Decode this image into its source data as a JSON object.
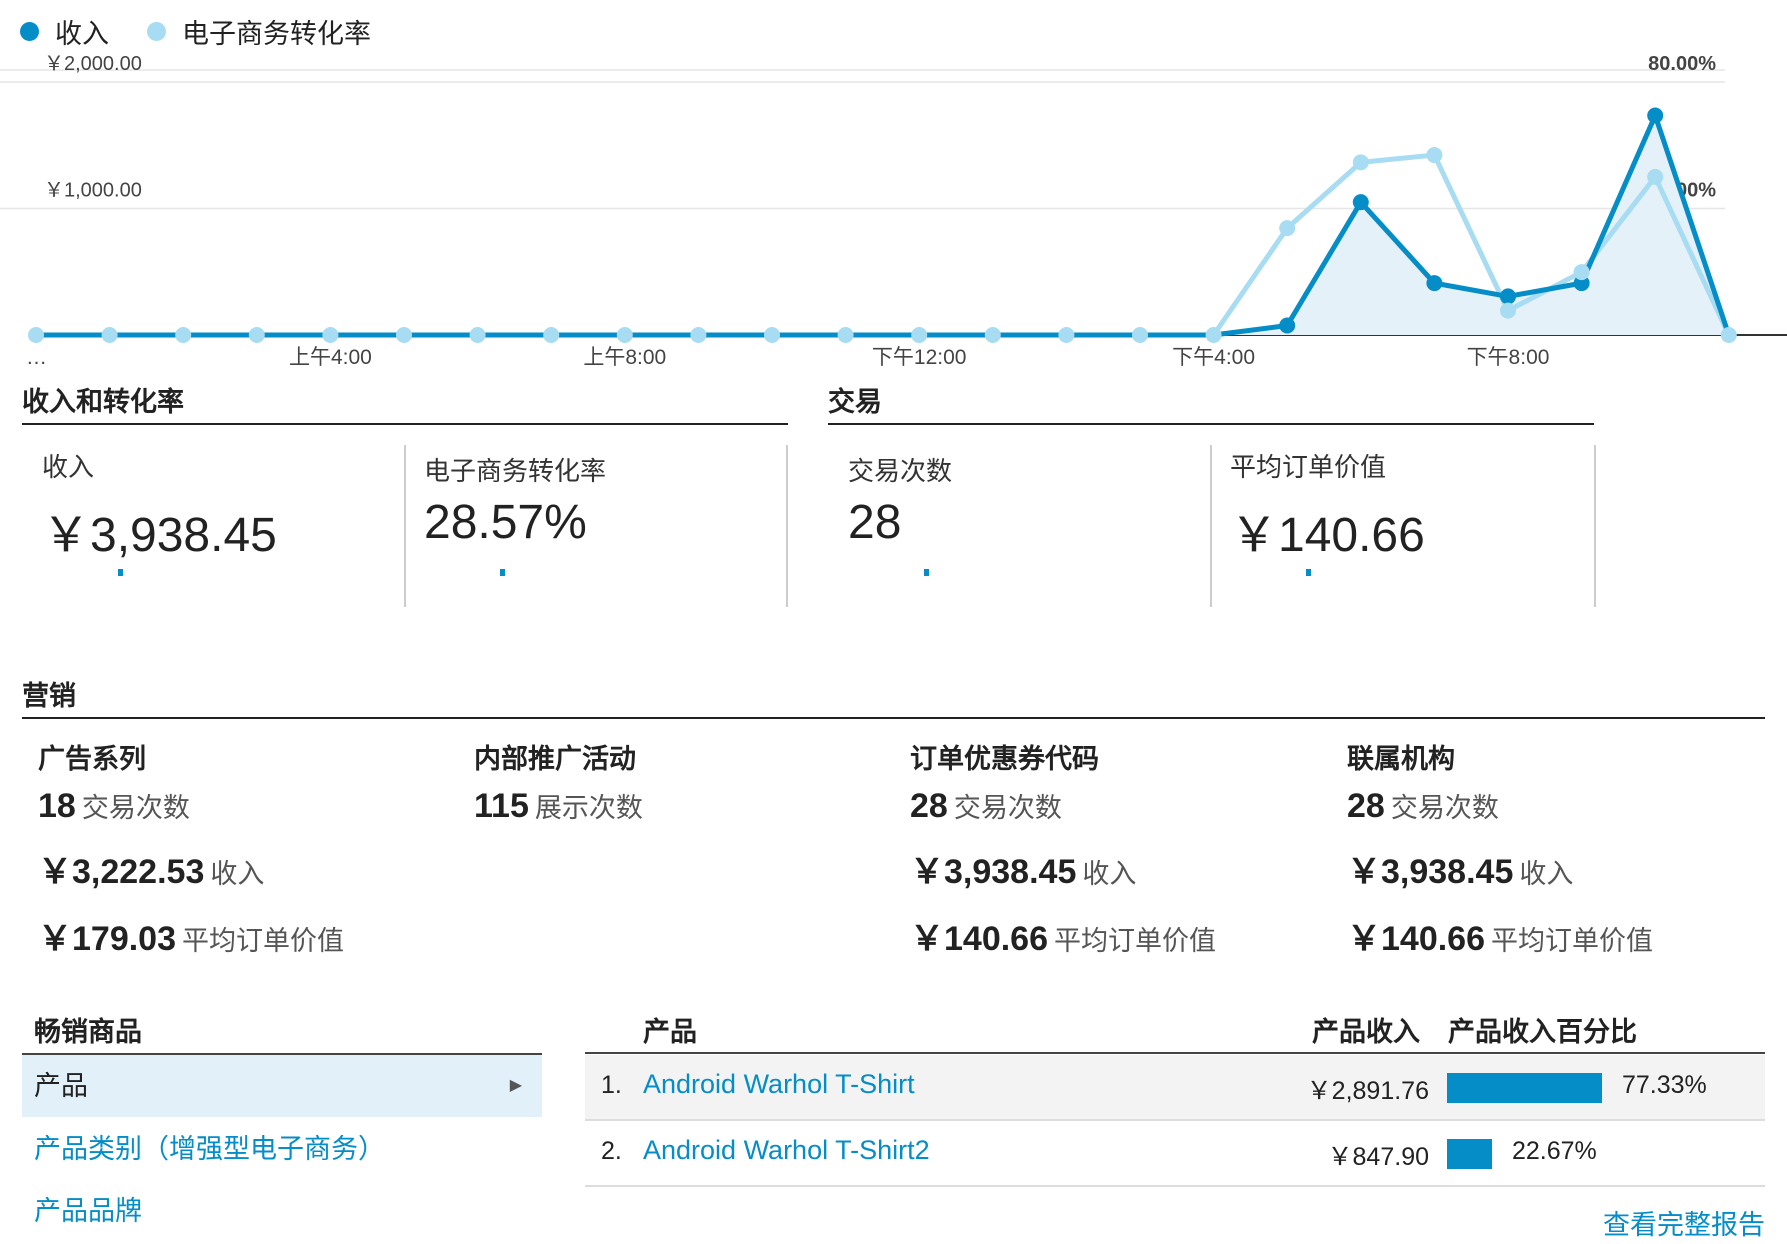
{
  "legend": {
    "revenue_label": "收入",
    "conversion_label": "电子商务转化率",
    "revenue_color": "#058dc7",
    "conversion_color": "#a7dcf2"
  },
  "chart_data": {
    "type": "line",
    "x": [
      "…",
      "",
      "",
      "",
      "上午4:00",
      "",
      "",
      "",
      "上午8:00",
      "",
      "",
      "",
      "下午12:00",
      "",
      "",
      "",
      "下午4:00",
      "",
      "",
      "",
      "下午8:00",
      "",
      "",
      "",
      ""
    ],
    "x_tick_labels": [
      "…",
      "上午4:00",
      "上午8:00",
      "下午12:00",
      "下午4:00",
      "下午8:00"
    ],
    "series": [
      {
        "name": "收入",
        "axis": "left",
        "values": [
          0,
          0,
          0,
          0,
          0,
          0,
          0,
          0,
          0,
          0,
          0,
          0,
          0,
          0,
          0,
          0,
          0,
          75,
          1050,
          410,
          305,
          410,
          1735,
          0
        ],
        "color": "#058dc7",
        "area": true
      },
      {
        "name": "电子商务转化率",
        "axis": "right",
        "values": [
          0,
          0,
          0,
          0,
          0,
          0,
          0,
          0,
          0,
          0,
          0,
          0,
          0,
          0,
          0,
          0,
          0,
          33.8,
          54.6,
          56.9,
          7.7,
          19.9,
          50.0,
          0
        ],
        "color": "#a7dcf2"
      }
    ],
    "y_left": {
      "ticks": [
        "￥2,000.00",
        "￥1,000.00"
      ],
      "tick_values": [
        2000,
        1000
      ],
      "range": [
        0,
        2000
      ]
    },
    "y_right": {
      "ticks": [
        "80.00%",
        "40.00%"
      ],
      "tick_values": [
        80,
        40
      ],
      "range": [
        0,
        80
      ]
    },
    "grid": true
  },
  "sections": {
    "rev_conv": "收入和转化率",
    "transactions": "交易",
    "marketing": "营销",
    "top_sellers": "畅销商品"
  },
  "metrics": [
    {
      "label": "收入",
      "value": "￥3,938.45"
    },
    {
      "label": "电子商务转化率",
      "value": "28.57%"
    },
    {
      "label": "交易次数",
      "value": "28"
    },
    {
      "label": "平均订单价值",
      "value": "￥140.66"
    }
  ],
  "marketing": [
    {
      "title": "广告系列",
      "rows": [
        {
          "num": "18",
          "label": "交易次数"
        },
        {
          "num": "￥3,222.53",
          "label": "收入"
        },
        {
          "num": "￥179.03",
          "label": "平均订单价值"
        }
      ]
    },
    {
      "title": "内部推广活动",
      "rows": [
        {
          "num": "115",
          "label": "展示次数"
        }
      ]
    },
    {
      "title": "订单优惠券代码",
      "rows": [
        {
          "num": "28",
          "label": "交易次数"
        },
        {
          "num": "￥3,938.45",
          "label": "收入"
        },
        {
          "num": "￥140.66",
          "label": "平均订单价值"
        }
      ]
    },
    {
      "title": "联属机构",
      "rows": [
        {
          "num": "28",
          "label": "交易次数"
        },
        {
          "num": "￥3,938.45",
          "label": "收入"
        },
        {
          "num": "￥140.66",
          "label": "平均订单价值"
        }
      ]
    }
  ],
  "top_sellers_nav": [
    {
      "label": "产品",
      "arrow": "▶"
    },
    {
      "label": "产品类别（增强型电子商务）"
    },
    {
      "label": "产品品牌"
    }
  ],
  "table": {
    "headers": [
      "产品",
      "产品收入",
      "产品收入百分比"
    ],
    "rows": [
      {
        "idx": "1.",
        "name": "Android Warhol T-Shirt",
        "revenue": "￥2,891.76",
        "percent": "77.33%",
        "share": 77.33
      },
      {
        "idx": "2.",
        "name": "Android Warhol T-Shirt2",
        "revenue": "￥847.90",
        "percent": "22.67%",
        "share": 22.67
      }
    ]
  },
  "full_report": "查看完整报告"
}
